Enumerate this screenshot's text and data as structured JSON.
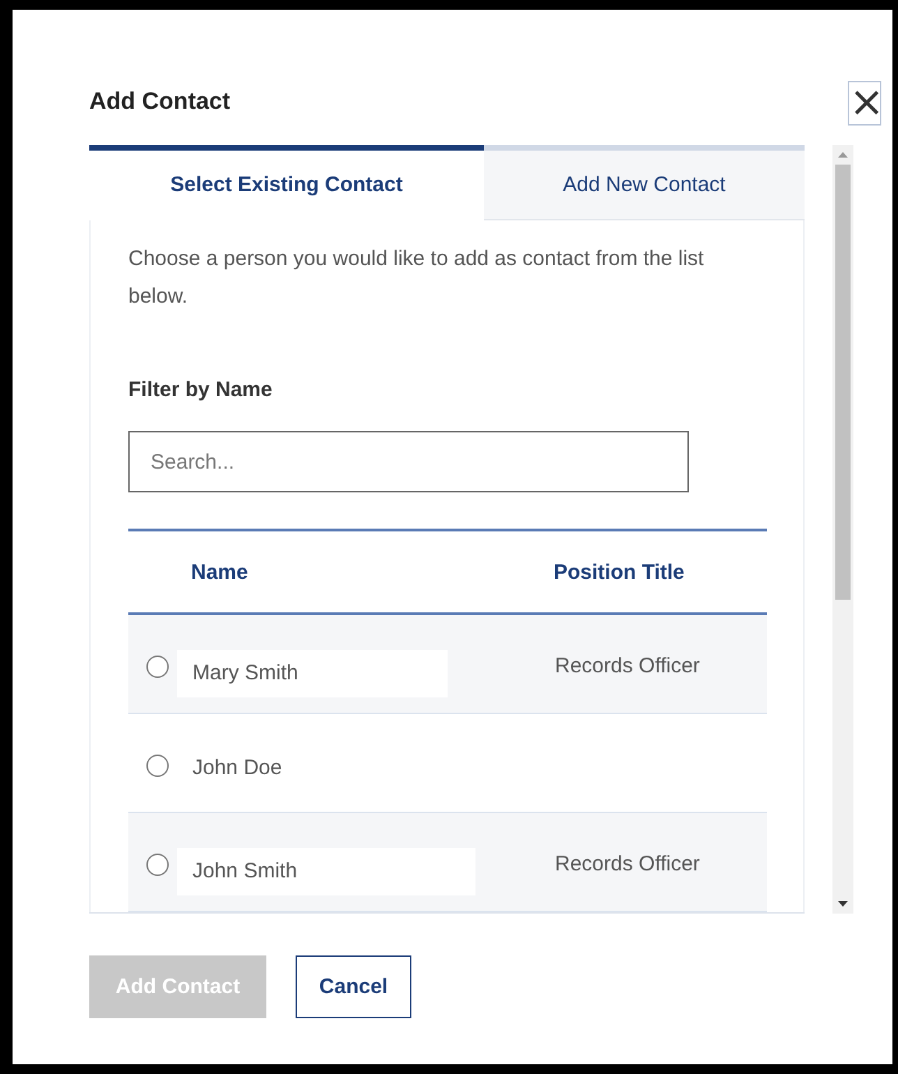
{
  "dialog": {
    "title": "Add Contact",
    "close": "×"
  },
  "tabs": [
    {
      "label": "Select Existing Contact",
      "selected": true
    },
    {
      "label": "Add New Contact",
      "selected": false
    }
  ],
  "intro": "Choose a person you would like to add as contact from the list below.",
  "filter": {
    "label": "Filter by Name",
    "placeholder": "Search..."
  },
  "table": {
    "columns": [
      "Name",
      "Position Title"
    ],
    "rows": [
      {
        "name": "Mary Smith",
        "position": "Records Officer",
        "selected": false
      },
      {
        "name": "John Doe",
        "selected": false
      },
      {
        "name": "John Smith",
        "position": "Records Officer",
        "selected": false
      }
    ]
  },
  "buttons": [
    {
      "label": "Add Contact",
      "kind": "primary",
      "disabled": true
    },
    {
      "label": "Cancel",
      "kind": "secondary",
      "disabled": false
    }
  ]
}
